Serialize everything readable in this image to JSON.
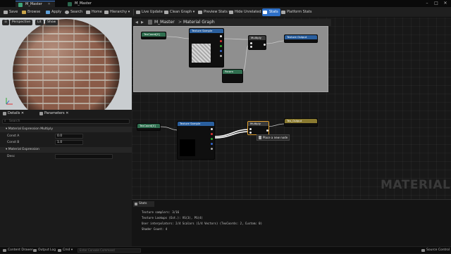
{
  "tabs": [
    {
      "label": "M_Master",
      "active": true
    },
    {
      "label": "M_Master",
      "active": false
    }
  ],
  "toolbar": {
    "save": "Save",
    "browse": "Browse",
    "apply": "Apply",
    "search": "Search",
    "home": "Home",
    "hierarchy": "Hierarchy",
    "live_update": "Live Update",
    "clean_graph": "Clean Graph",
    "preview_stats": "Preview Stats",
    "hide_unrelated": "Hide Unrelated",
    "stats": "Stats",
    "platform_stats": "Platform Stats"
  },
  "viewport": {
    "perspective": "Perspective",
    "lit": "Lit",
    "show": "Show"
  },
  "details": {
    "tab_details": "Details",
    "tab_parameters": "Parameters",
    "search_placeholder": "Search",
    "sec_multiply": "Material Expression Multiply",
    "const_a_label": "Const A",
    "const_a_value": "0.0",
    "const_b_label": "Const B",
    "const_b_value": "1.0",
    "sec_expression": "Material Expression",
    "desc_label": "Desc"
  },
  "graph": {
    "breadcrumb_root": "M_Master",
    "breadcrumb_sep": ">",
    "breadcrumb_leaf": "Material Graph",
    "watermark": "MATERIAL",
    "context_menu": "Place a new node"
  },
  "stats": {
    "header": "Stats",
    "lines": [
      "Texture samplers: 3/16",
      "Texture Lookups (Est.): VS(3), PS(4)",
      "User interpolators: 2/4 Scalars (1/4 Vectors) (TexCoords: 2, Custom: 0)",
      "Shader Count: 4"
    ]
  },
  "statusbar": {
    "content_drawer": "Content Drawer",
    "output_log": "Output Log",
    "cmd": "Cmd",
    "console_placeholder": "Enter Console Command",
    "source_control": "Source Control"
  },
  "colors": {
    "accent": "#2d6fc7",
    "node_texture": "#2a5f9e",
    "node_param": "#2f6e4f",
    "node_math": "#3b3b3b"
  }
}
